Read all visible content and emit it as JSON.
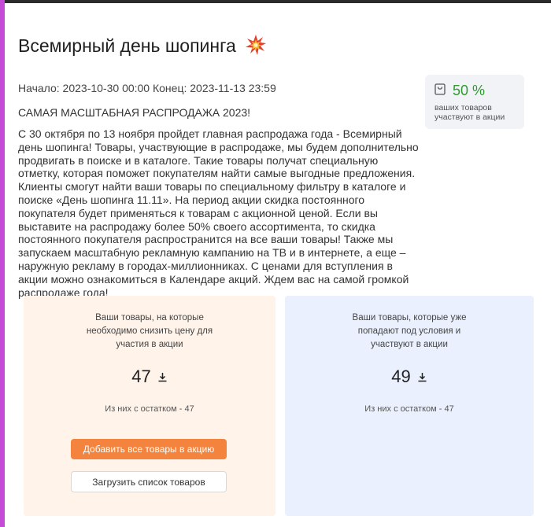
{
  "promotion": {
    "title": "Всемирный день шопинга",
    "title_icon": "explosion-icon",
    "dates": "Начало: 2023-10-30 00:00 Конец: 2023-11-13 23:59",
    "headline": "САМАЯ МАСШТАБНАЯ РАСПРОДАЖА 2023!",
    "description": "С 30 октября по 13 ноября пройдет главная распродажа года - Всемирный день шопинга! Товары, участвующие в распродаже, мы будем дополнительно продвигать в поиске и в каталоге. Такие товары получат специальную отметку, которая поможет покупателям найти самые выгодные предложения. Клиенты смогут найти ваши товары по специальному фильтру в каталоге и поиске «День шопинга 11.11». На период акции скидка постоянного покупателя будет применяться к товарам с акционной ценой. Если вы выставите на распродажу более 50% своего ассортимента, то скидка постоянного покупателя распространится на все ваши товары! Также мы запускаем масштабную рекламную кампанию на ТВ и в интернете, а еще – наружную рекламу в городах-миллионниках. С ценами для вступления в акции можно ознакомиться в Календаре акций. Ждем вас на самой громкой распродаже года!"
  },
  "stat": {
    "percent": "50 %",
    "caption": "ваших товаров участвуют в акции",
    "icon": "shopping-bag-icon",
    "color": "#2e9b2e"
  },
  "cards": {
    "need_discount": {
      "title": "Ваши товары, на которые необходимо снизить цену для участия в акции",
      "count": "47",
      "stock": "Из них с остатком - 47",
      "add_all_button": "Добавить все товары в акцию",
      "upload_button": "Загрузить список товаров",
      "bg_color": "#fff3ea"
    },
    "eligible": {
      "title": "Ваши товары, которые уже попадают под условия и участвуют в акции",
      "count": "49",
      "stock": "Из них с остатком - 47",
      "bg_color": "#eaf0fd"
    }
  },
  "colors": {
    "accent": "#f4843d",
    "left_bar": "#c34bd6"
  }
}
